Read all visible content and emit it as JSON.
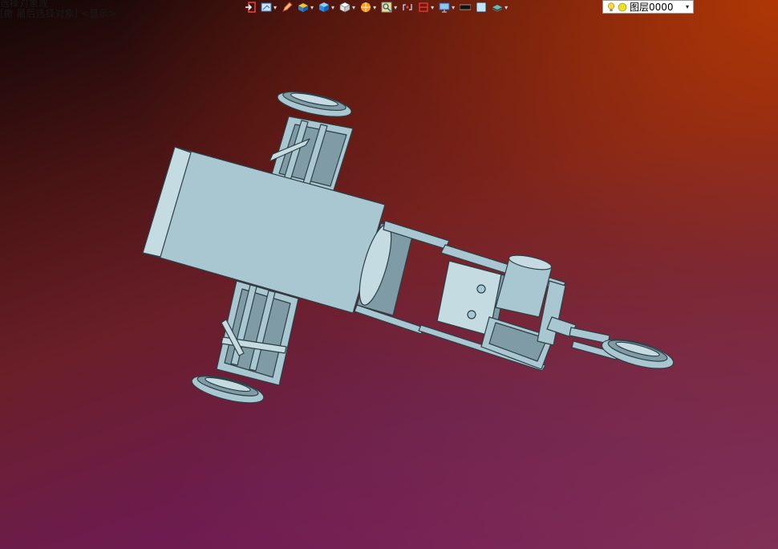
{
  "prompt_lines": [
    "选择对象或",
    "[撤 最后选择对象] <显示>"
  ],
  "toolbar": {
    "tools": [
      {
        "name": "insert-icon",
        "dropdown": false
      },
      {
        "name": "draw-icon",
        "dropdown": true
      },
      {
        "name": "pencil-icon",
        "dropdown": false
      },
      {
        "name": "solid-box-icon",
        "dropdown": true
      },
      {
        "name": "cube-blue-icon",
        "dropdown": true
      },
      {
        "name": "cube-white-icon",
        "dropdown": true
      },
      {
        "name": "sphere-icon",
        "dropdown": true
      },
      {
        "name": "zoom-icon",
        "dropdown": true
      },
      {
        "name": "orbit-icon",
        "dropdown": false
      },
      {
        "name": "section-icon",
        "dropdown": true
      },
      {
        "name": "viewport-icon",
        "dropdown": true
      },
      {
        "name": "color-black-icon",
        "dropdown": false
      },
      {
        "name": "color-lightblue-icon",
        "dropdown": false
      },
      {
        "name": "layers-icon",
        "dropdown": true
      }
    ],
    "dropdown_glyph": "▾"
  },
  "layer": {
    "name": "图层0000",
    "arrow": "▾",
    "bulb_color": "#f5d742",
    "sun_color": "#e8e020"
  },
  "colors": {
    "model_face": "#a9c7d0",
    "model_face_light": "#c4dbe2",
    "model_edge": "#2e3d44",
    "model_shadow": "#7f9ca6"
  }
}
